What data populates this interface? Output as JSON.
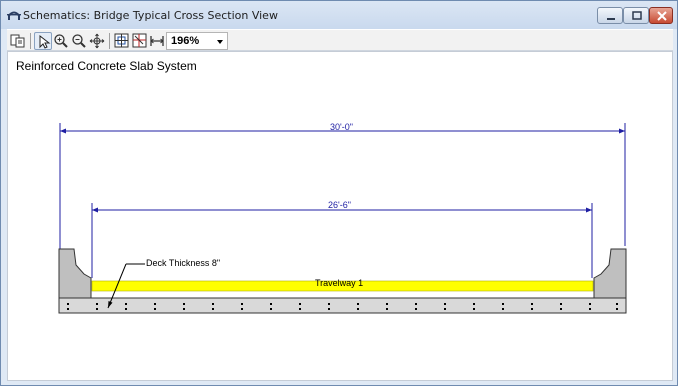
{
  "window": {
    "title": "Schematics: Bridge Typical Cross Section View"
  },
  "toolbar": {
    "zoom_value": "196%"
  },
  "view": {
    "heading": "Reinforced Concrete Slab System",
    "overall_width": "30'-0\"",
    "travelway_width": "26'-6\"",
    "deck_thickness": "Deck Thickness 8\"",
    "travelway_label": "Travelway 1"
  },
  "colors": {
    "dimension": "#1f1fa3",
    "travelway": "#ffff00",
    "slab": "#d9d9d9",
    "barrier": "#bfbfbf"
  }
}
